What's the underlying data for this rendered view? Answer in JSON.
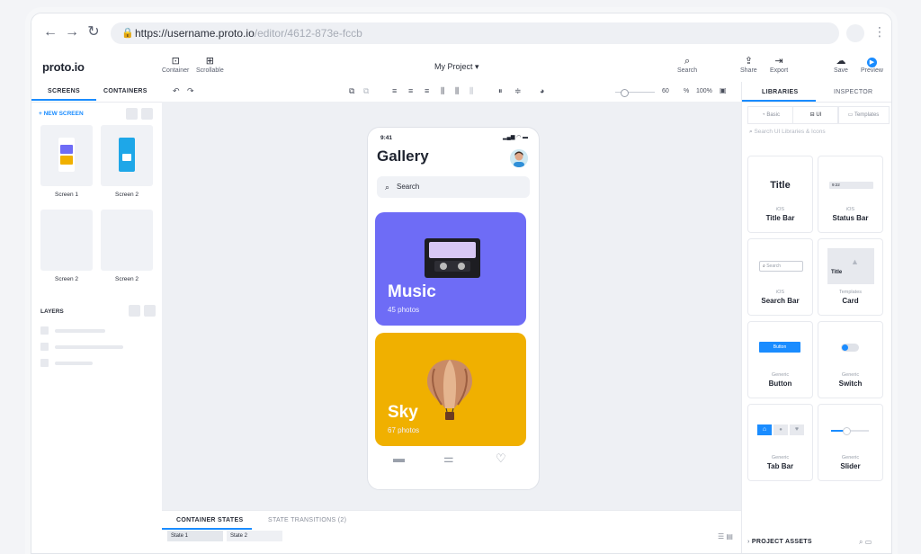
{
  "browser": {
    "url_host": "https://username.proto.io",
    "url_path": "/editor/4612-873e-fccb"
  },
  "app": {
    "logo": "proto.io",
    "project_name": "My Project ▾",
    "tools": {
      "container": "Container",
      "scrollable": "Scrollable",
      "search": "Search",
      "share": "Share",
      "export": "Export",
      "save": "Save",
      "preview": "Preview"
    }
  },
  "left_panel": {
    "tabs": [
      "SCREENS",
      "CONTAINERS"
    ],
    "new_screen": "+ NEW SCREEN",
    "screens": [
      {
        "label": "Screen 1"
      },
      {
        "label": "Screen 2"
      },
      {
        "label": "Screen 2"
      },
      {
        "label": "Screen 2"
      }
    ],
    "layers_title": "LAYERS"
  },
  "canvas_toolbar": {
    "zoom_value": "60",
    "zoom_unit": "%",
    "zoom_fit": "100%"
  },
  "phone": {
    "time": "9:41",
    "title": "Gallery",
    "search_placeholder": "Search",
    "cards": [
      {
        "title": "Music",
        "subtitle": "45 photos",
        "color": "#6e6cf6"
      },
      {
        "title": "Sky",
        "subtitle": "67 photos",
        "color": "#f0b000"
      }
    ]
  },
  "bottom": {
    "tabs": [
      "CONTAINER STATES",
      "STATE TRANSITIONS (2)"
    ],
    "states": [
      "State 1",
      "State 2"
    ]
  },
  "right_panel": {
    "tabs": [
      "LIBRARIES",
      "INSPECTOR"
    ],
    "segments": [
      "Basic",
      "UI",
      "Templates"
    ],
    "search_placeholder": "Search UI Libraries & Icons",
    "components": [
      {
        "category": "iOS",
        "name": "Title Bar",
        "preview_text": "Title"
      },
      {
        "category": "iOS",
        "name": "Status Bar",
        "preview_text": "9:22"
      },
      {
        "category": "iOS",
        "name": "Search Bar",
        "preview_text": "Search"
      },
      {
        "category": "Templates",
        "name": "Card",
        "preview_text": "Title"
      },
      {
        "category": "Generic",
        "name": "Button",
        "preview_text": "Button"
      },
      {
        "category": "Generic",
        "name": "Switch",
        "preview_text": ""
      },
      {
        "category": "Generic",
        "name": "Tab Bar",
        "preview_text": ""
      },
      {
        "category": "Generic",
        "name": "Slider",
        "preview_text": ""
      }
    ],
    "assets_title": "PROJECT ASSETS"
  },
  "colors": {
    "accent": "#1a8cff",
    "music_card": "#6e6cf6",
    "sky_card": "#f0b000"
  }
}
